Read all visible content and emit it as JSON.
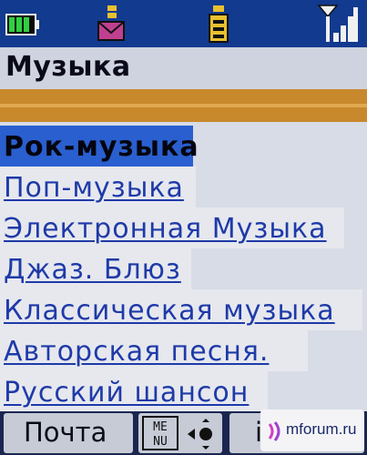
{
  "status": {
    "battery_icon": "battery-icon",
    "message_icon": "message-icon",
    "java_icon": "java-icon",
    "signal_icon": "signal-strength-icon",
    "battery_level": 0.75,
    "signal_bars": 4
  },
  "title": "Музыка",
  "list": {
    "items": [
      {
        "label": "Рок-музыка",
        "selected": true
      },
      {
        "label": "Поп-музыка",
        "selected": false
      },
      {
        "label": "Электронная Музыка",
        "selected": false
      },
      {
        "label": "Джаз. Блюз",
        "selected": false
      },
      {
        "label": "Классическая музыка",
        "selected": false
      },
      {
        "label": "Авторская песня.",
        "selected": false
      },
      {
        "label": "Русский шансон",
        "selected": false
      }
    ]
  },
  "softkeys": {
    "left_label": "Почта",
    "menu_top": "ME",
    "menu_bottom": "NU",
    "right_label": "i"
  },
  "watermark": "mforum.ru",
  "colors": {
    "status_bg": "#123a8e",
    "title_bg": "#cfd3df",
    "accent_band": "#c8882c",
    "list_bg": "#d7dce6",
    "link_text": "#1f3aa8",
    "selected_bg": "#2a5fcf"
  }
}
